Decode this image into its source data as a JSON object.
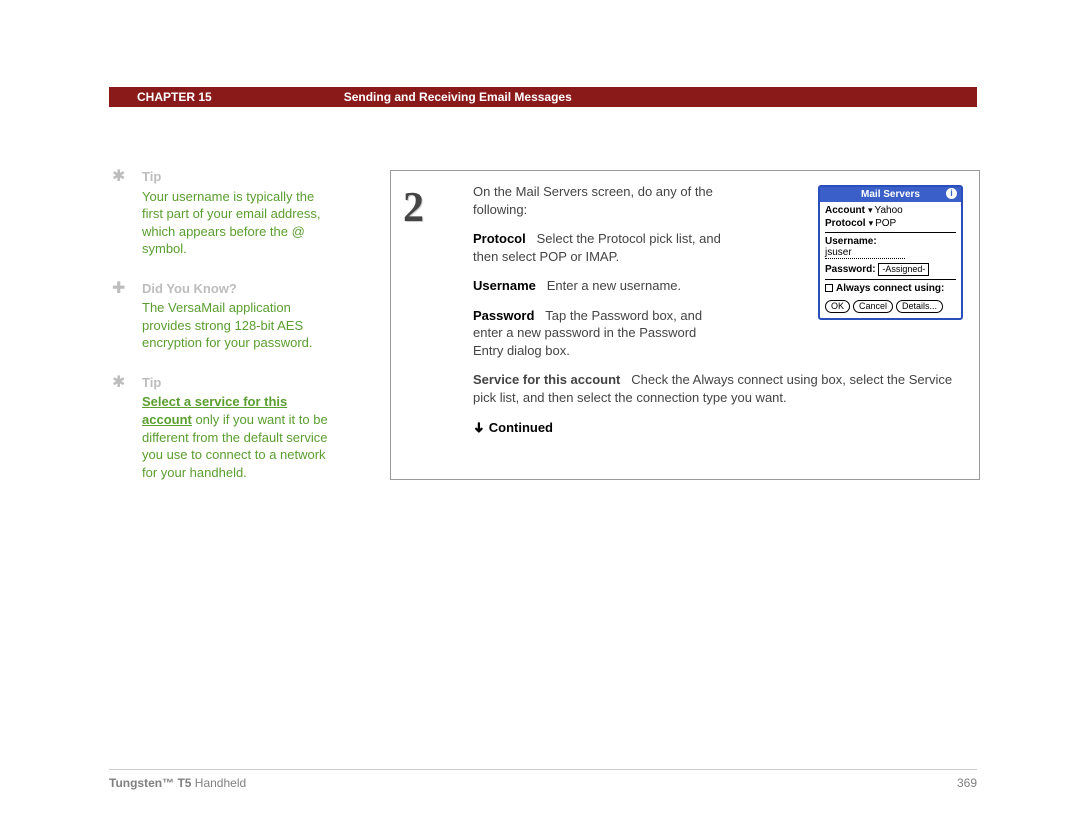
{
  "header": {
    "chapter": "CHAPTER 15",
    "title": "Sending and Receiving Email Messages"
  },
  "footer": {
    "product_bold": "Tungsten™ T5",
    "product_rest": " Handheld",
    "page": "369"
  },
  "sidebar": {
    "items": [
      {
        "icon": "✱",
        "head": "Tip",
        "body": "Your username is typically the first part of your email address, which appears before the @ symbol."
      },
      {
        "icon": "✚",
        "head": "Did You Know?",
        "body": "The VersaMail application provides strong 128-bit AES encryption for your password."
      },
      {
        "icon": "✱",
        "head": "Tip",
        "link": "Select a service for this account",
        "body_rest": " only if you want it to be different from the default service you use to connect to a network for your handheld."
      }
    ]
  },
  "step": {
    "number": "2",
    "intro": "On the Mail Servers screen, do any of the following:",
    "protocol_label": "Protocol",
    "protocol_text": "Select the Protocol pick list, and then select POP or IMAP.",
    "username_label": "Username",
    "username_text": "Enter a new username.",
    "password_label": "Password",
    "password_text": "Tap the Password box, and enter a new password in the Password Entry dialog box.",
    "service_label": "Service for this account",
    "service_text": "Check the Always connect using box, select the Service pick list, and then select the connection type you want.",
    "continued": "Continued"
  },
  "device": {
    "title": "Mail Servers",
    "info": "i",
    "account_label": "Account",
    "account_value": "Yahoo",
    "protocol_label": "Protocol",
    "protocol_value": "POP",
    "username_label": "Username:",
    "username_value": "jsuser",
    "password_label": "Password:",
    "password_value": "-Assigned-",
    "always_label": "Always connect using:",
    "buttons": {
      "ok": "OK",
      "cancel": "Cancel",
      "details": "Details..."
    }
  }
}
